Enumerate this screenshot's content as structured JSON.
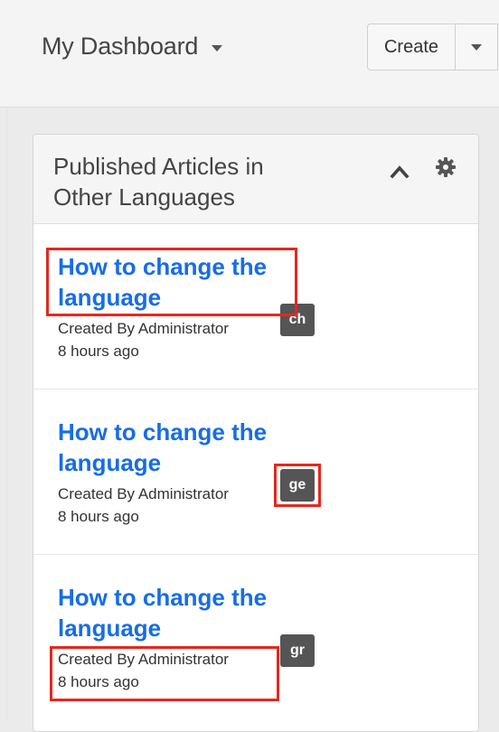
{
  "header": {
    "dashboard_label": "My Dashboard",
    "create_label": "Create"
  },
  "dashlet": {
    "title": "Published Articles in Other Languages",
    "articles": [
      {
        "title": "How to change the language",
        "created_by": "Created By Administrator",
        "time_ago": "8 hours ago",
        "lang": "ch"
      },
      {
        "title": "How to change the language",
        "created_by": "Created By Administrator",
        "time_ago": "8 hours ago",
        "lang": "ge"
      },
      {
        "title": "How to change the language",
        "created_by": "Created By Administrator",
        "time_ago": "8 hours ago",
        "lang": "gr"
      }
    ]
  },
  "icons": {
    "dashboard_caret": "chevron-down-icon",
    "create_caret": "chevron-down-icon",
    "collapse": "chevron-up-icon",
    "settings": "gear-icon"
  },
  "colors": {
    "link": "#176de5",
    "highlight": "#e5281d",
    "badge": "#555555",
    "header_bg": "#f4f4f4"
  }
}
